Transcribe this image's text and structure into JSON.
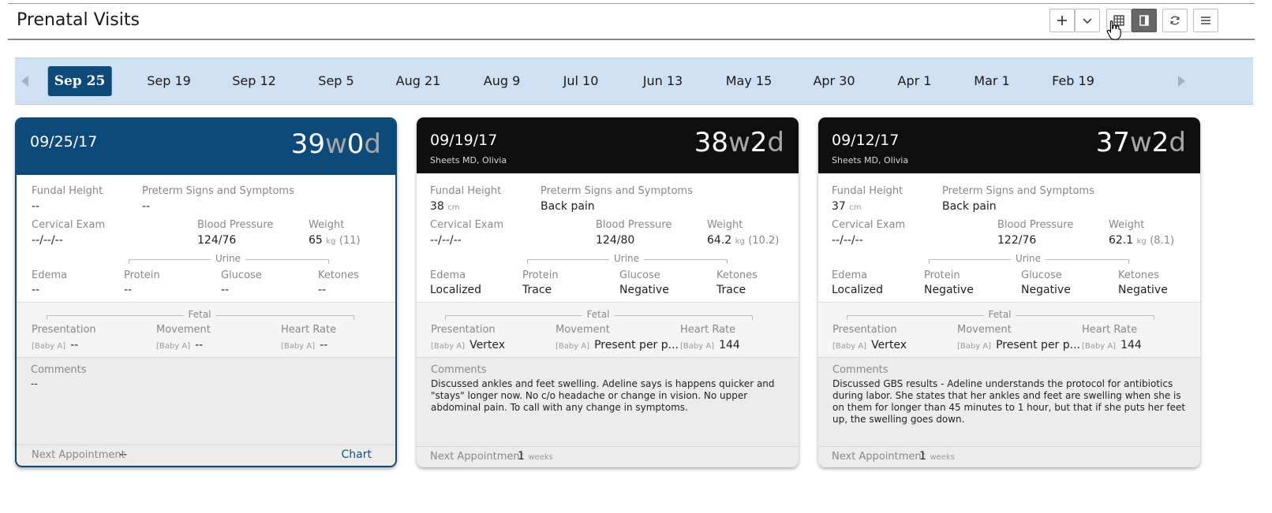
{
  "header": {
    "title": "Prenatal Visits"
  },
  "dates": [
    "Sep 25",
    "Sep 19",
    "Sep 12",
    "Sep 5",
    "Aug 21",
    "Aug 9",
    "Jul 10",
    "Jun 13",
    "May 15",
    "Apr 30",
    "Apr 1",
    "Mar 1",
    "Feb 19"
  ],
  "selected_date": "Sep 25",
  "labels": {
    "fundal": "Fundal Height",
    "preterm": "Preterm Signs and Symptoms",
    "cervical": "Cervical Exam",
    "bp": "Blood Pressure",
    "weight": "Weight",
    "urine": "Urine",
    "edema": "Edema",
    "protein": "Protein",
    "glucose": "Glucose",
    "ketones": "Ketones",
    "fetal": "Fetal",
    "presentation": "Presentation",
    "movement": "Movement",
    "heart_rate": "Heart Rate",
    "comments": "Comments",
    "next_appt": "Next Appointment",
    "baby": "[Baby A]",
    "cm": "cm",
    "kg": "kg",
    "weeks": "weeks",
    "chart": "Chart"
  },
  "cards": [
    {
      "date": "09/25/17",
      "provider": "",
      "ga_w_num": "39",
      "ga_w": "w",
      "ga_d_num": "0",
      "ga_d": "d",
      "fundal": "--",
      "fundal_unit": "",
      "preterm": "--",
      "cervical": "--/--/--",
      "bp": "124/76",
      "weight": "65",
      "weight_change": "(11)",
      "edema": "--",
      "protein": "--",
      "glucose": "--",
      "ketones": "--",
      "presentation": "--",
      "movement": "--",
      "heart_rate": "--",
      "comments": "--",
      "next_appt": "--",
      "next_unit": "",
      "chart_link": "Chart"
    },
    {
      "date": "09/19/17",
      "provider": "Sheets MD, Olivia",
      "ga_w_num": "38",
      "ga_w": "w",
      "ga_d_num": "2",
      "ga_d": "d",
      "fundal": "38",
      "fundal_unit": "cm",
      "preterm": "Back pain",
      "cervical": "--/--/--",
      "bp": "124/80",
      "weight": "64.2",
      "weight_change": "(10.2)",
      "edema": "Localized",
      "protein": "Trace",
      "glucose": "Negative",
      "ketones": "Trace",
      "presentation": "Vertex",
      "movement": "Present per p...",
      "heart_rate": "144",
      "comments": "Discussed ankles and feet swelling. Adeline says is happens quicker and \"stays\" longer now. No c/o headache or change in vision. No upper abdominal pain. To call with any change in symptoms.",
      "next_appt": "1",
      "next_unit": "weeks",
      "chart_link": ""
    },
    {
      "date": "09/12/17",
      "provider": "Sheets MD, Olivia",
      "ga_w_num": "37",
      "ga_w": "w",
      "ga_d_num": "2",
      "ga_d": "d",
      "fundal": "37",
      "fundal_unit": "cm",
      "preterm": "Back pain",
      "cervical": "--/--/--",
      "bp": "122/76",
      "weight": "62.1",
      "weight_change": "(8.1)",
      "edema": "Localized",
      "protein": "Negative",
      "glucose": "Negative",
      "ketones": "Negative",
      "presentation": "Vertex",
      "movement": "Present per p...",
      "heart_rate": "144",
      "comments": "Discussed GBS results - Adeline understands the protocol for antibiotics during labor. She states that her ankles and feet are swelling when she is on them for longer than 45 minutes to 1 hour, but that if she puts her feet up, the swelling goes down.",
      "next_appt": "1",
      "next_unit": "weeks",
      "chart_link": ""
    }
  ],
  "icons": {
    "add": "plus-icon",
    "dropdown": "chevron-down-icon",
    "grid": "grid-view-icon",
    "panel": "panel-view-icon",
    "refresh": "refresh-icon",
    "menu": "hamburger-menu-icon"
  }
}
